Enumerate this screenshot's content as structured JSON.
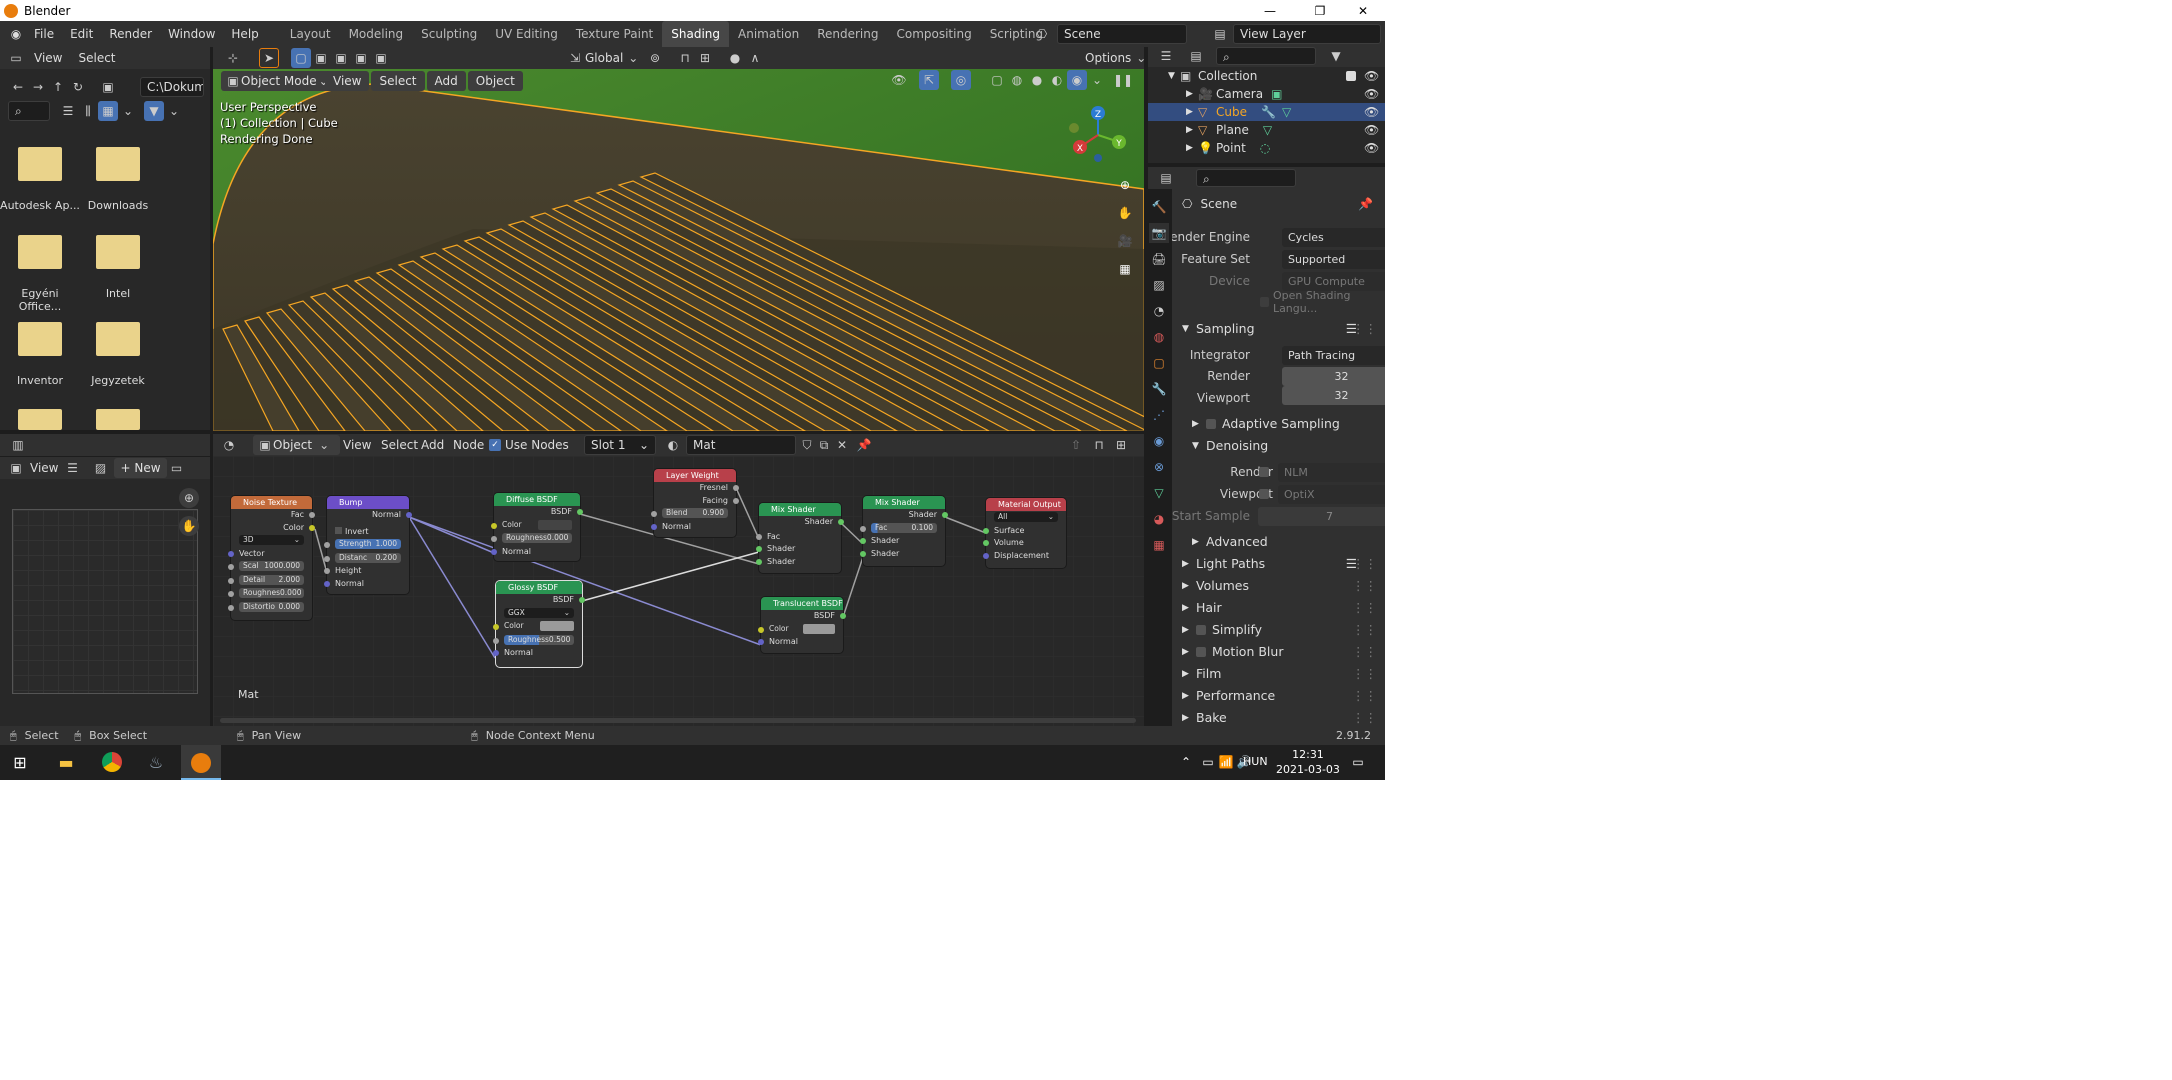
{
  "app": {
    "title": "Blender",
    "version": "2.91.2"
  },
  "menus": [
    "File",
    "Edit",
    "Render",
    "Window",
    "Help"
  ],
  "workspaces": [
    "Layout",
    "Modeling",
    "Sculpting",
    "UV Editing",
    "Texture Paint",
    "Shading",
    "Animation",
    "Rendering",
    "Compositing",
    "Scripting"
  ],
  "active_workspace": "Shading",
  "scene": {
    "name": "Scene",
    "view_layer": "View Layer"
  },
  "filebrowser": {
    "menu_view": "View",
    "menu_select": "Select",
    "path": "C:\\Dokum...",
    "items": [
      "Autodesk Ap...",
      "Downloads",
      "Egyéni Office...",
      "Intel",
      "Inventor",
      "Jegyzetek",
      "",
      ""
    ]
  },
  "imageeditor": {
    "view": "View",
    "new": "New",
    "new_prefix": "+"
  },
  "viewport": {
    "mode": "Object Mode",
    "menus": [
      "View",
      "Select",
      "Add",
      "Object"
    ],
    "orientation": "Global",
    "options": "Options",
    "info": [
      "User Perspective",
      "(1) Collection | Cube",
      "Rendering Done"
    ],
    "gizmo": {
      "x": "X",
      "y": "Y",
      "z": "Z"
    }
  },
  "nodeeditor": {
    "type": "Object",
    "menus": [
      "View",
      "Select",
      "Add",
      "Node"
    ],
    "use_nodes": "Use Nodes",
    "slot": "Slot 1",
    "material": "Mat",
    "overlay_label": "Mat",
    "nodes": {
      "noise": {
        "title": "Noise Texture",
        "out1": "Fac",
        "out2": "Color",
        "dim": "3D",
        "vector": "Vector",
        "scale_l": "Scal",
        "scale_v": "1000.000",
        "detail_l": "Detail",
        "detail_v": "2.000",
        "rough_l": "Roughnes",
        "rough_v": "0.000",
        "dist_l": "Distortio",
        "dist_v": "0.000"
      },
      "bump": {
        "title": "Bump",
        "out": "Normal",
        "invert": "Invert",
        "strength_l": "Strength",
        "strength_v": "1.000",
        "dist_l": "Distanc",
        "dist_v": "0.200",
        "height": "Height",
        "normal": "Normal"
      },
      "diffuse": {
        "title": "Diffuse BSDF",
        "out": "BSDF",
        "color": "Color",
        "rough_l": "Roughness",
        "rough_v": "0.000",
        "normal": "Normal"
      },
      "glossy": {
        "title": "Glossy BSDF",
        "out": "BSDF",
        "dist": "GGX",
        "color": "Color",
        "rough_l": "Roughness",
        "rough_v": "0.500",
        "normal": "Normal"
      },
      "layer": {
        "title": "Layer Weight",
        "out1": "Fresnel",
        "out2": "Facing",
        "blend_l": "Blend",
        "blend_v": "0.900",
        "normal": "Normal"
      },
      "mix1": {
        "title": "Mix Shader",
        "out": "Shader",
        "fac": "Fac",
        "s1": "Shader",
        "s2": "Shader"
      },
      "mix2": {
        "title": "Mix Shader",
        "out": "Shader",
        "fac_l": "Fac",
        "fac_v": "0.100",
        "s1": "Shader",
        "s2": "Shader"
      },
      "trans": {
        "title": "Translucent BSDF",
        "out": "BSDF",
        "color": "Color",
        "normal": "Normal"
      },
      "output": {
        "title": "Material Output",
        "target": "All",
        "surface": "Surface",
        "volume": "Volume",
        "disp": "Displacement"
      }
    }
  },
  "outliner": {
    "items": [
      {
        "name": "Collection",
        "indent": 0
      },
      {
        "name": "Camera",
        "indent": 1
      },
      {
        "name": "Cube",
        "indent": 1,
        "selected": true
      },
      {
        "name": "Plane",
        "indent": 1
      },
      {
        "name": "Point",
        "indent": 1
      }
    ]
  },
  "properties": {
    "header": "Scene",
    "render_engine_l": "Render Engine",
    "render_engine": "Cycles",
    "feature_set_l": "Feature Set",
    "feature_set": "Supported",
    "device_l": "Device",
    "device": "GPU Compute",
    "osl": "Open Shading Langu...",
    "sampling": "Sampling",
    "integrator_l": "Integrator",
    "integrator": "Path Tracing",
    "render_l": "Render",
    "render_v": "32",
    "viewport_l": "Viewport",
    "viewport_v": "32",
    "adaptive": "Adaptive Sampling",
    "denoising": "Denoising",
    "den_render_l": "Render",
    "den_render_v": "NLM",
    "den_viewport_l": "Viewport",
    "den_viewport_v": "OptiX",
    "start_sample_l": "Start Sample",
    "start_sample_v": "7",
    "advanced": "Advanced",
    "sections": [
      "Light Paths",
      "Volumes",
      "Hair",
      "Simplify",
      "Motion Blur",
      "Film",
      "Performance",
      "Bake"
    ]
  },
  "statusbar": {
    "select": "Select",
    "box_select": "Box Select",
    "pan": "Pan View",
    "context": "Node Context Menu"
  },
  "taskbar": {
    "lang": "HUN",
    "time": "12:31",
    "date": "2021-03-03"
  },
  "colors": {
    "accent": "#4772b3",
    "selection_orange": "#f5a623",
    "grass": "#3a7a28"
  }
}
